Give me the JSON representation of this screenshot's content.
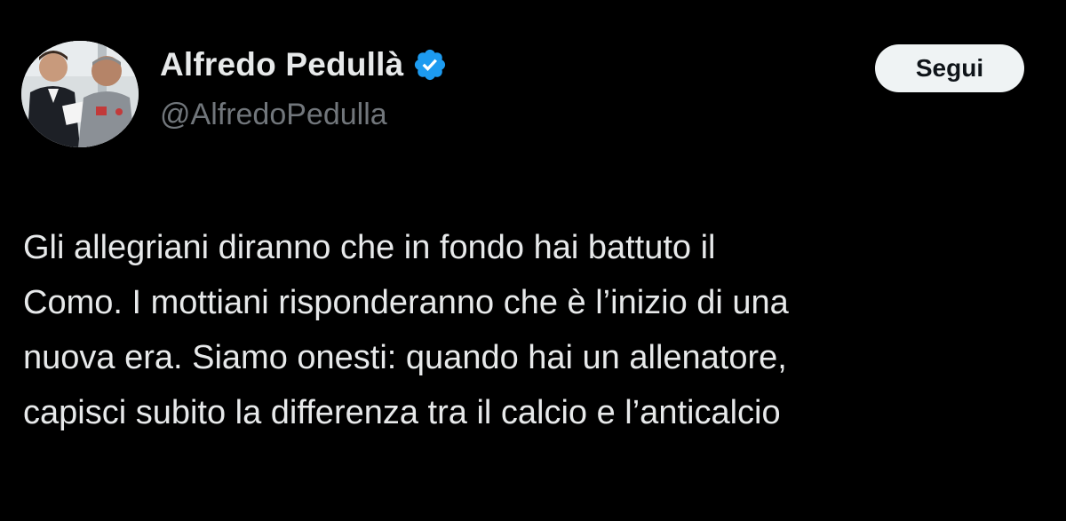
{
  "author": {
    "display_name": "Alfredo Pedullà",
    "handle": "@AlfredoPedulla",
    "verified_icon": "verified-badge-icon",
    "avatar": "profile-photo"
  },
  "actions": {
    "follow_label": "Segui"
  },
  "tweet": {
    "lines": [
      "Gli allegriani diranno che in fondo hai battuto il",
      "Como. I mottiani risponderanno che è l’inizio di una",
      "nuova era. Siamo onesti: quando hai un allenatore,",
      "capisci subito la differenza tra il calcio e l’anticalcio"
    ]
  },
  "colors": {
    "background": "#000000",
    "text_primary": "#e7e9ea",
    "text_secondary": "#71767b",
    "verified_blue": "#1d9bf0",
    "button_bg": "#eff3f4"
  }
}
